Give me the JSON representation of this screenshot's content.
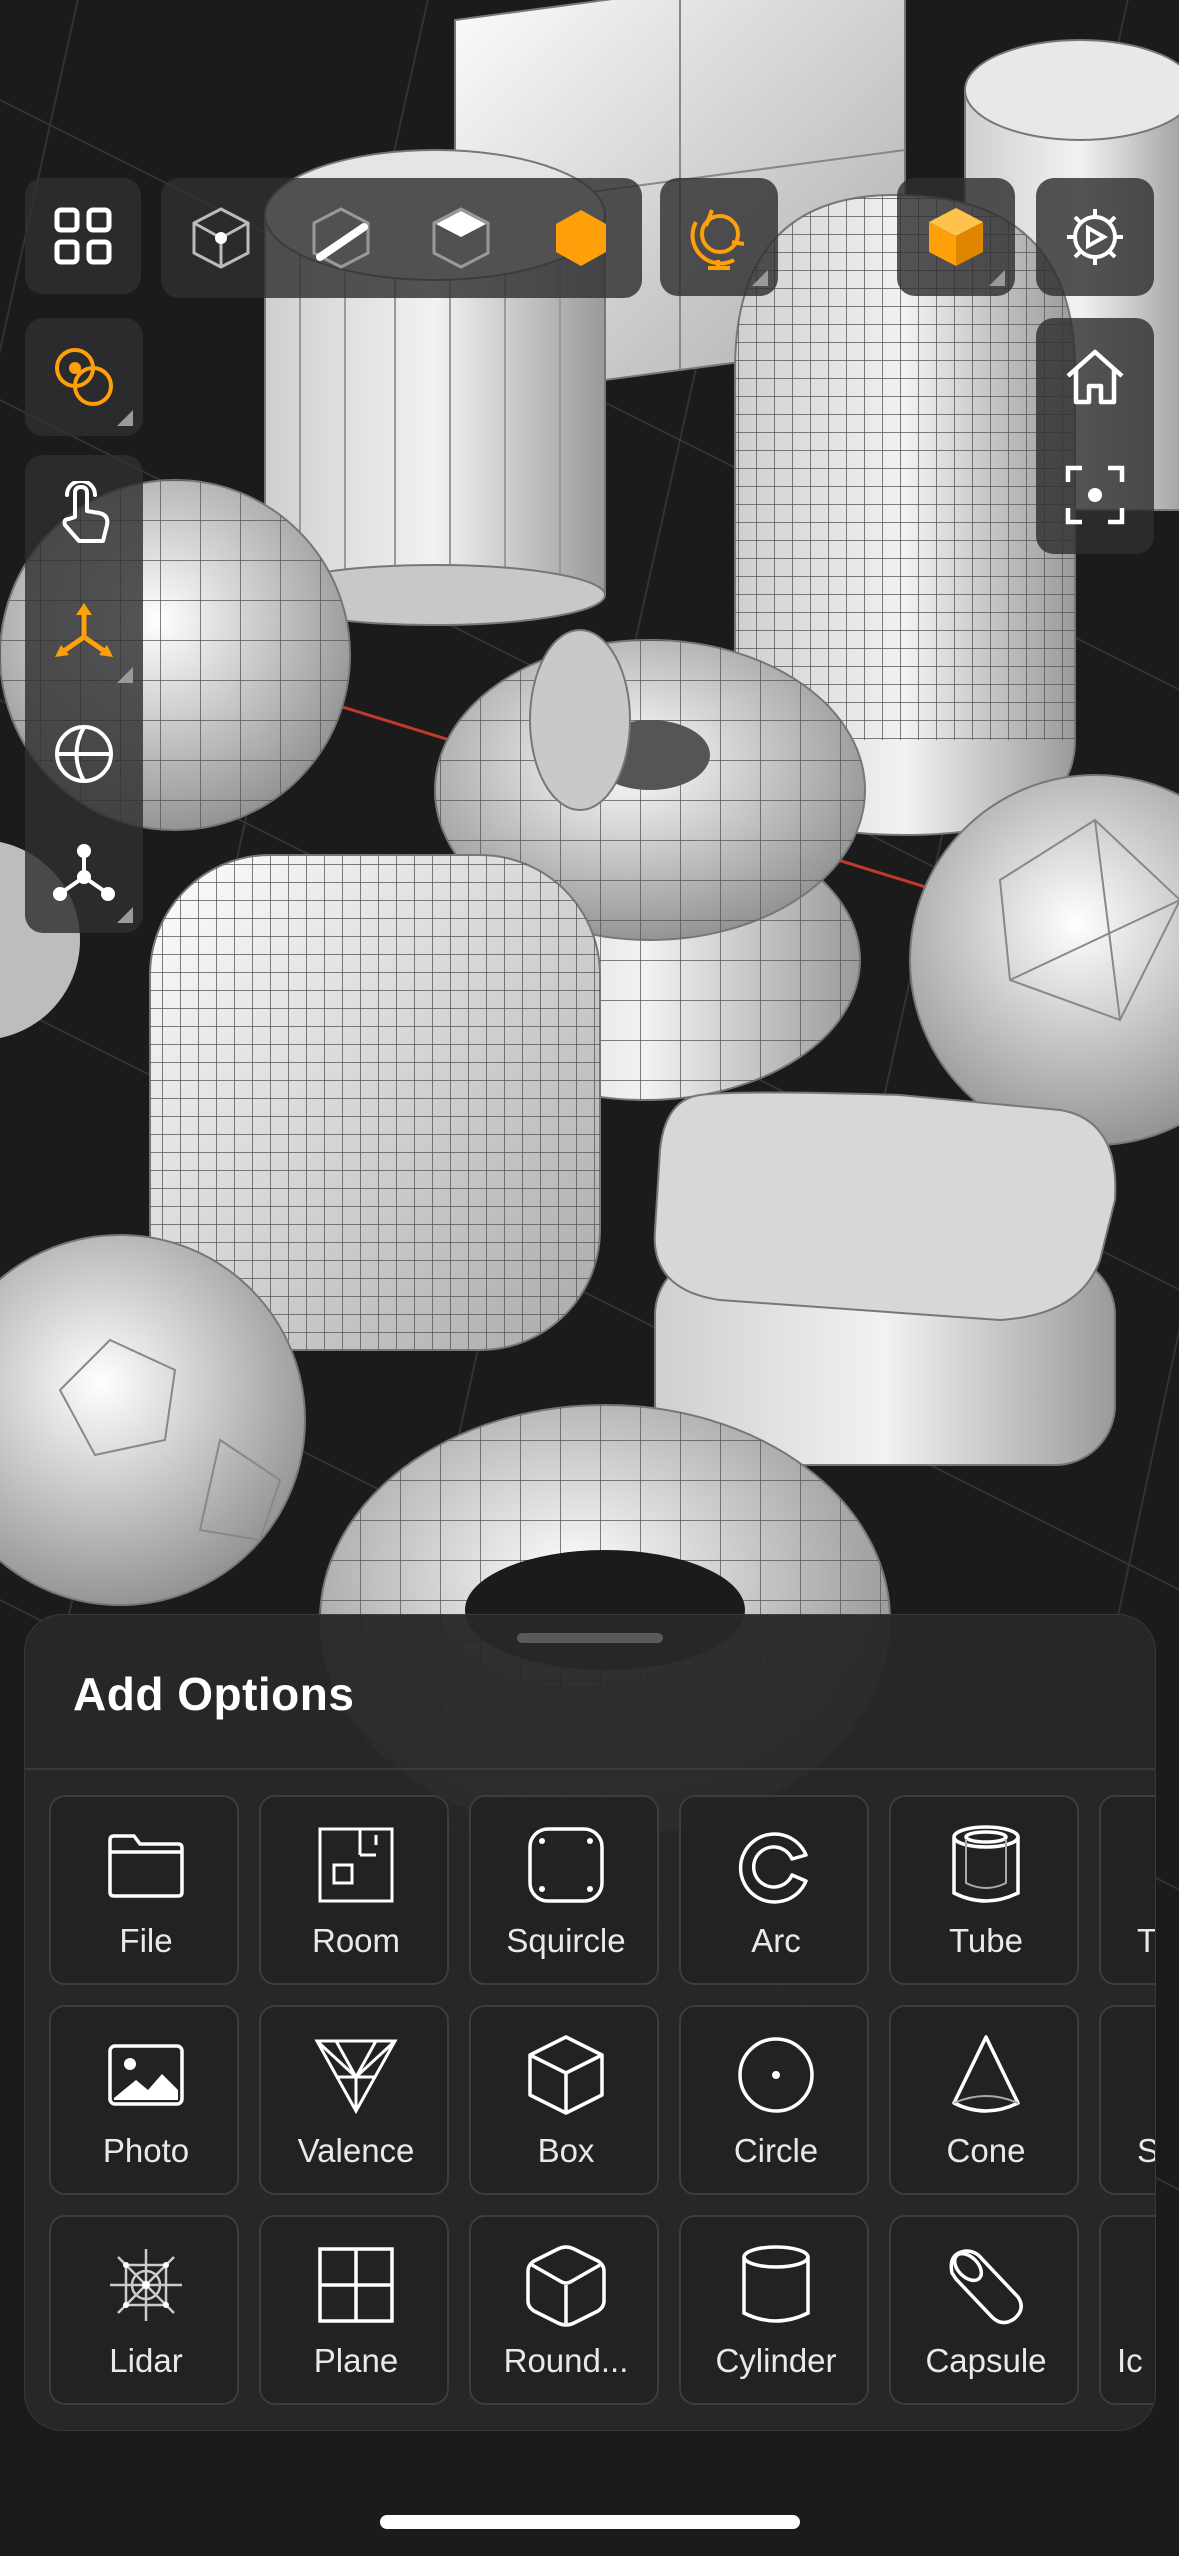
{
  "colors": {
    "accent": "#ff9f0a",
    "background": "#1b1b1c",
    "panel": "#303032"
  },
  "toolbar": {
    "top_left": "grid-icon",
    "selection_modes": [
      "vertex-mode-icon",
      "edge-mode-icon",
      "face-mode-icon",
      "object-mode-icon"
    ],
    "orbit": "orbit-globe-icon",
    "view_cube": "view-cube-icon",
    "settings": "settings-gear-icon"
  },
  "left_tools": [
    "pivot-icon",
    "touch-hand-icon",
    "transform-gizmo-icon",
    "sphere-wireframe-icon",
    "hierarchy-nodes-icon"
  ],
  "right_tools": [
    "home-icon",
    "focus-frame-icon"
  ],
  "sheet": {
    "title": "Add Options",
    "rows": [
      [
        {
          "label": "File",
          "icon": "folder-icon"
        },
        {
          "label": "Room",
          "icon": "room-icon"
        },
        {
          "label": "Squircle",
          "icon": "squircle-icon"
        },
        {
          "label": "Arc",
          "icon": "arc-icon"
        },
        {
          "label": "Tube",
          "icon": "tube-icon"
        },
        {
          "label": "T",
          "icon": "partial-icon"
        }
      ],
      [
        {
          "label": "Photo",
          "icon": "photo-icon"
        },
        {
          "label": "Valence",
          "icon": "valence-icon"
        },
        {
          "label": "Box",
          "icon": "box-icon"
        },
        {
          "label": "Circle",
          "icon": "circle-icon"
        },
        {
          "label": "Cone",
          "icon": "cone-icon"
        },
        {
          "label": "S",
          "icon": "partial-icon"
        }
      ],
      [
        {
          "label": "Lidar",
          "icon": "lidar-icon"
        },
        {
          "label": "Plane",
          "icon": "plane-icon"
        },
        {
          "label": "Round...",
          "icon": "rounded-box-icon"
        },
        {
          "label": "Cylinder",
          "icon": "cylinder-icon"
        },
        {
          "label": "Capsule",
          "icon": "capsule-icon"
        },
        {
          "label": "Ic",
          "icon": "partial-icon"
        }
      ]
    ]
  }
}
